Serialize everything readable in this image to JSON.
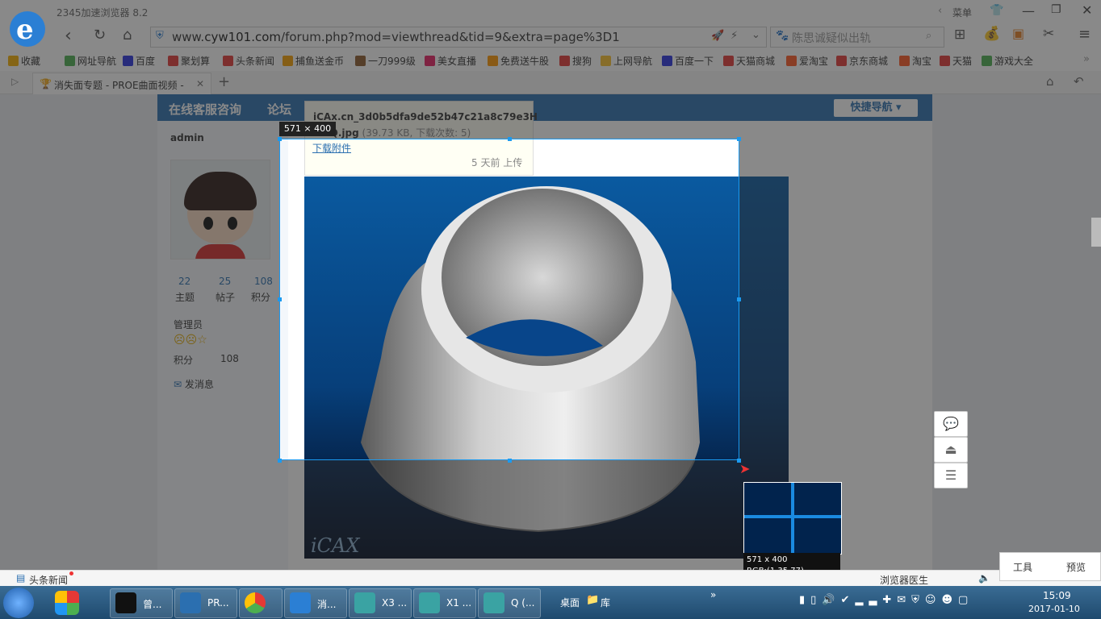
{
  "window": {
    "title": "2345加速浏览器 8.2",
    "menu_label": "菜单"
  },
  "address": {
    "url_prefix": "www.",
    "url_domain": "cyw101.com",
    "url_path": "/forum.php?mod=viewthread&tid=9&extra=page%3D1"
  },
  "search": {
    "placeholder": "陈思诚疑似出轨"
  },
  "bookmarks": [
    {
      "label": "收藏",
      "color": "#f5b000"
    },
    {
      "label": "网址导航",
      "color": "#4caf50"
    },
    {
      "label": "百度",
      "color": "#2932e1"
    },
    {
      "label": "聚划算",
      "color": "#e53935"
    },
    {
      "label": "头条新闻",
      "color": "#e53935"
    },
    {
      "label": "捕鱼送金币",
      "color": "#f5a000"
    },
    {
      "label": "一刀999级",
      "color": "#8d5a2b"
    },
    {
      "label": "美女直播",
      "color": "#e91e63"
    },
    {
      "label": "免费送牛股",
      "color": "#ff9800"
    },
    {
      "label": "搜狗",
      "color": "#e53935"
    },
    {
      "label": "上网导航",
      "color": "#fbc02d"
    },
    {
      "label": "百度一下",
      "color": "#2932e1"
    },
    {
      "label": "天猫商城",
      "color": "#e53935"
    },
    {
      "label": "爱淘宝",
      "color": "#ff5722"
    },
    {
      "label": "京东商城",
      "color": "#e53935"
    },
    {
      "label": "淘宝",
      "color": "#ff5722"
    },
    {
      "label": "天猫",
      "color": "#e53935"
    },
    {
      "label": "游戏大全",
      "color": "#4caf50"
    }
  ],
  "tab": {
    "label": "消失面专题 - PROE曲面视频 -"
  },
  "forum": {
    "nav_service": "在线客服咨询",
    "nav_forum": "论坛",
    "quick_nav": "快捷导航",
    "username": "admin",
    "stats": [
      {
        "value": "22",
        "label": "主题"
      },
      {
        "value": "25",
        "label": "帖子"
      },
      {
        "value": "108",
        "label": "积分"
      }
    ],
    "role": "管理员",
    "points_label": "积分",
    "points_value": "108",
    "send_message": "发消息"
  },
  "attachment": {
    "filename_line1": "iCAx.cn_3d0b5dfa9de52b47c21a8c79e3H",
    "filename_line2": "emQ.jpg",
    "meta": "(39.73 KB, 下载次数: 5)",
    "download": "下载附件",
    "uploaded": "5 天前 上传",
    "image_logo": "iCAX"
  },
  "capture": {
    "size_label": "571 × 400",
    "info_size": "571 x 400",
    "info_rgb": "RGB:(1,35,77)"
  },
  "statusbar": {
    "news": "头条新闻",
    "doctor": "浏览器医生",
    "tools": "工具",
    "preview": "预览"
  },
  "taskbar": {
    "items": [
      "曾...",
      "PR...",
      "",
      "消...",
      "X3 ...",
      "X1 ...",
      "Q (..."
    ],
    "desktop": "桌面",
    "library": "库",
    "time": "15:09",
    "date": "2017-01-10"
  }
}
